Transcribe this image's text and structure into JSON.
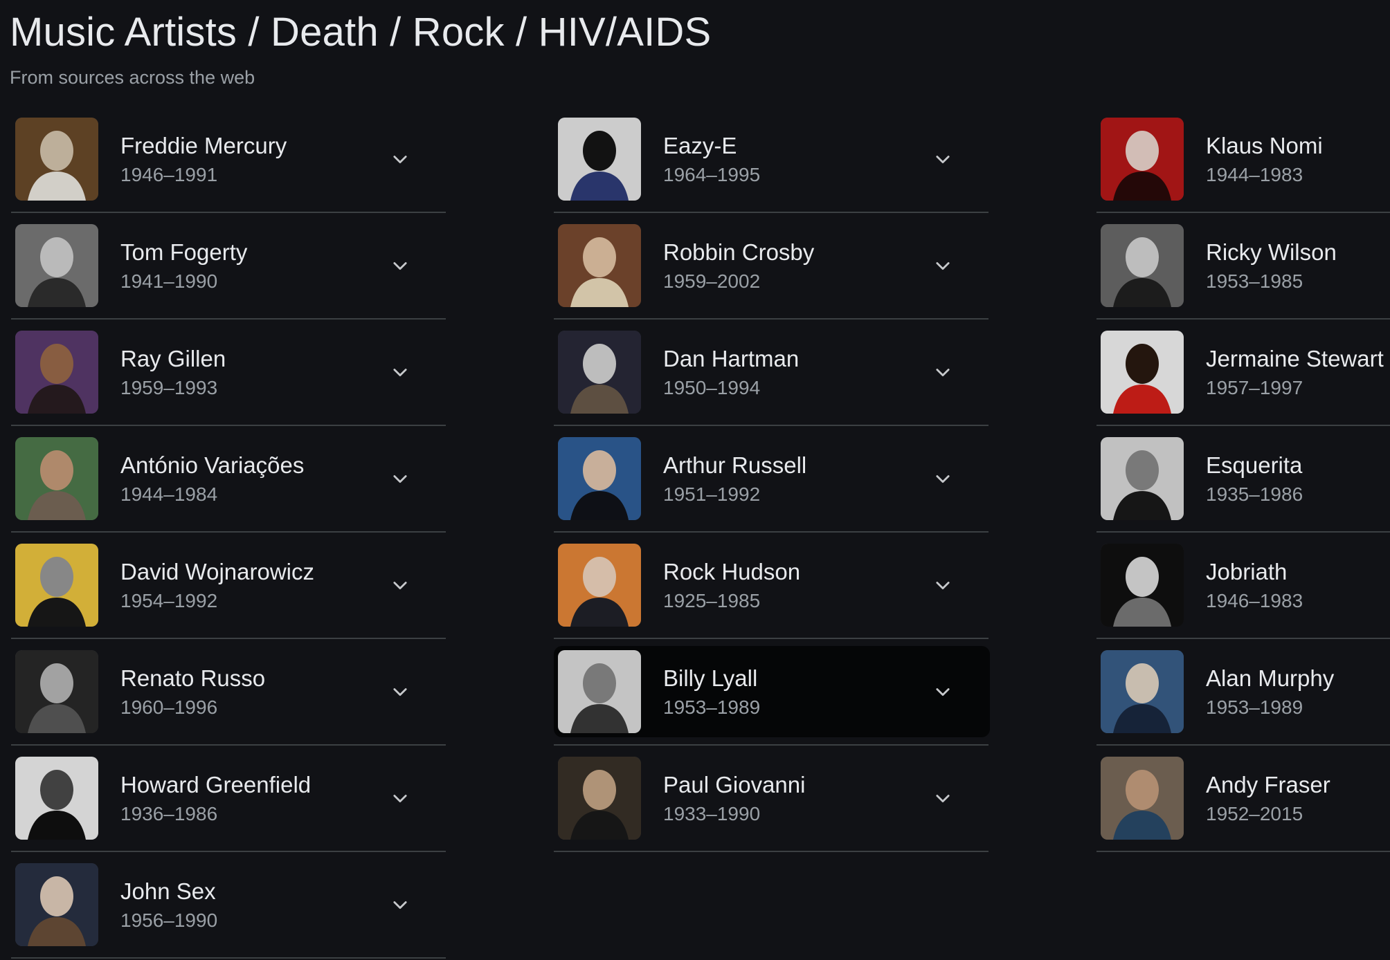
{
  "header": {
    "title": "Music Artists / Death / Rock / HIV/AIDS",
    "subtitle": "From sources across the web"
  },
  "columns": [
    [
      {
        "name": "Freddie Mercury",
        "years": "1946–1991",
        "palette": [
          "#6a4a2a",
          "#d8c8b0",
          "#f0ece4"
        ]
      },
      {
        "name": "Tom Fogerty",
        "years": "1941–1990",
        "palette": [
          "#7a7a7a",
          "#d4d4d4",
          "#303030"
        ]
      },
      {
        "name": "Ray Gillen",
        "years": "1959–1993",
        "palette": [
          "#5a3b6f",
          "#9b6a4a",
          "#2a1d22"
        ]
      },
      {
        "name": "António Variações",
        "years": "1944–1984",
        "palette": [
          "#4f7a4d",
          "#c89c7a",
          "#7a6a5a"
        ]
      },
      {
        "name": "David Wojnarowicz",
        "years": "1954–1992",
        "palette": [
          "#f0c840",
          "#9a9a9a",
          "#1a1a1a"
        ]
      },
      {
        "name": "Renato Russo",
        "years": "1960–1996",
        "palette": [
          "#2a2a2a",
          "#b9b9b9",
          "#5a5a5a"
        ]
      },
      {
        "name": "Howard Greenfield",
        "years": "1936–1986",
        "palette": [
          "#f2f2f2",
          "#4a4a4a",
          "#111111"
        ]
      },
      {
        "name": "John Sex",
        "years": "1956–1990",
        "palette": [
          "#2a3245",
          "#e4d0be",
          "#6a4f3a"
        ]
      }
    ],
    [
      {
        "name": "Eazy-E",
        "years": "1964–1995",
        "palette": [
          "#e9e9e9",
          "#151515",
          "#2f3d7a"
        ]
      },
      {
        "name": "Robbin Crosby",
        "years": "1959–2002",
        "palette": [
          "#7a4a30",
          "#e8c8a8",
          "#f0e0c0"
        ]
      },
      {
        "name": "Dan Hartman",
        "years": "1950–1994",
        "palette": [
          "#2a2a3a",
          "#d8d8d8",
          "#6a5a4a"
        ]
      },
      {
        "name": "Arthur Russell",
        "years": "1951–1992",
        "palette": [
          "#2f5f9a",
          "#e4c8b0",
          "#10131a"
        ]
      },
      {
        "name": "Rock Hudson",
        "years": "1925–1985",
        "palette": [
          "#e8883a",
          "#f3d8c1",
          "#20222a"
        ]
      },
      {
        "name": "Billy Lyall",
        "years": "1953–1989",
        "palette": [
          "#e0e0e0",
          "#8a8a8a",
          "#3a3a3a"
        ]
      },
      {
        "name": "Paul Giovanni",
        "years": "1933–1990",
        "palette": [
          "#3a3228",
          "#c8a888",
          "#1a1a1a"
        ]
      }
    ],
    [
      {
        "name": "Klaus Nomi",
        "years": "1944–1983",
        "palette": [
          "#b81818",
          "#f0d8d0",
          "#2a0a0a"
        ]
      },
      {
        "name": "Ricky Wilson",
        "years": "1953–1985",
        "palette": [
          "#6a6a6a",
          "#d8d8d8",
          "#202020"
        ]
      },
      {
        "name": "Jermaine Stewart",
        "years": "1957–1997",
        "palette": [
          "#f5f5f5",
          "#2a1a10",
          "#d8201a"
        ]
      },
      {
        "name": "Esquerita",
        "years": "1935–1986",
        "palette": [
          "#dcdcdc",
          "#8a8a8a",
          "#1a1a1a"
        ]
      },
      {
        "name": "Jobriath",
        "years": "1946–1983",
        "palette": [
          "#101010",
          "#e0e0e0",
          "#7a7a7a"
        ]
      },
      {
        "name": "Alan Murphy",
        "years": "1953–1989",
        "palette": [
          "#3a5f8a",
          "#e4d8c8",
          "#1a2840"
        ]
      },
      {
        "name": "Andy Fraser",
        "years": "1952–2015",
        "palette": [
          "#7a6a5a",
          "#c8a080",
          "#2a4a6a"
        ]
      }
    ]
  ]
}
